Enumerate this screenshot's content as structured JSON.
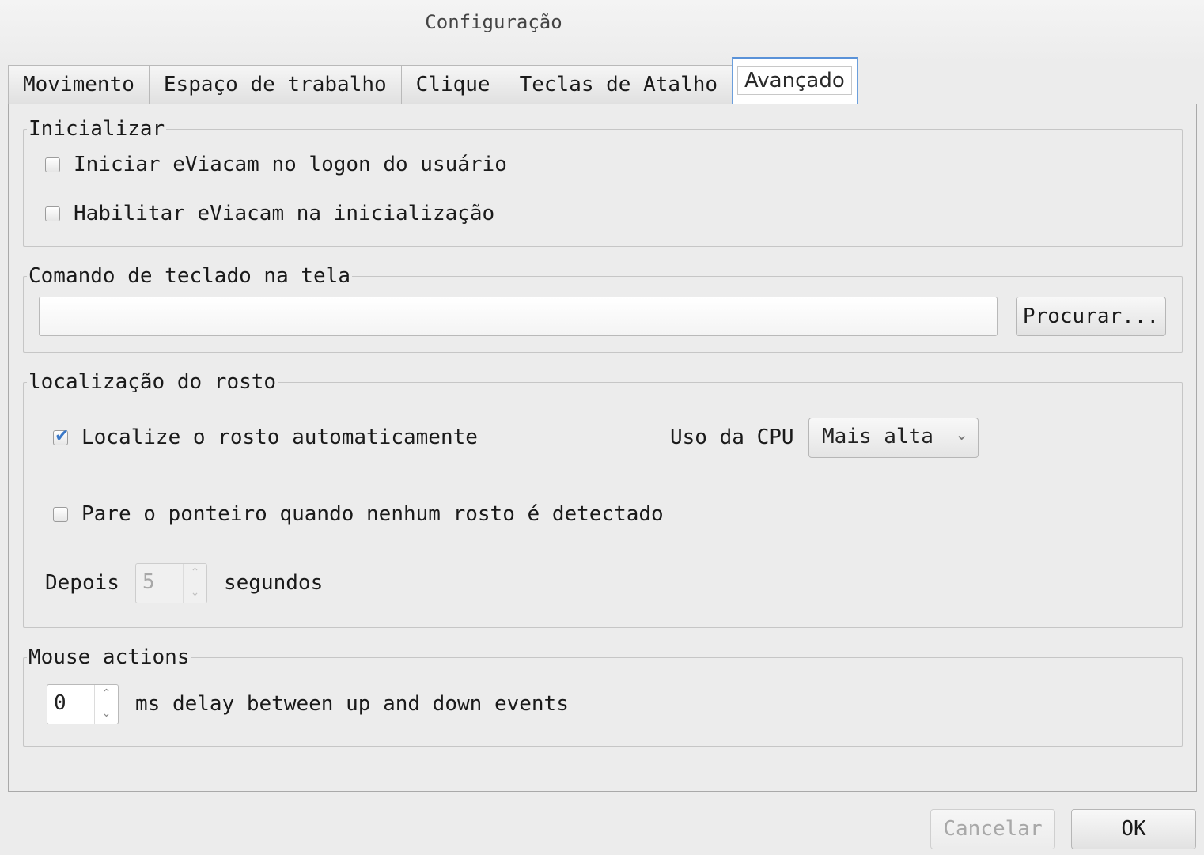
{
  "window": {
    "title": "Configuração"
  },
  "tabs": [
    {
      "label": "Movimento"
    },
    {
      "label": "Espaço de trabalho"
    },
    {
      "label": "Clique"
    },
    {
      "label": "Teclas de Atalho"
    },
    {
      "label": "Avançado",
      "active": true
    }
  ],
  "startup": {
    "legend": "Inicializar",
    "start_on_logon": {
      "label": "Iniciar eViacam no logon do usuário",
      "checked": false
    },
    "enable_on_startup": {
      "label": "Habilitar eViacam na inicialização",
      "checked": false
    }
  },
  "onscreen_keyboard": {
    "legend": "Comando de teclado na tela",
    "command_value": "",
    "browse_label": "Procurar..."
  },
  "face_location": {
    "legend": "localização do rosto",
    "auto_locate": {
      "label": "Localize o rosto automaticamente",
      "checked": true
    },
    "cpu_usage_label": "Uso da CPU",
    "cpu_usage_value": "Mais alta",
    "stop_pointer": {
      "label": "Pare o ponteiro quando nenhum rosto é detectado",
      "checked": false
    },
    "after_label": "Depois",
    "after_value": "5",
    "seconds_label": "segundos"
  },
  "mouse_actions": {
    "legend": "Mouse actions",
    "delay_value": "0",
    "delay_label": "ms delay between up and down events"
  },
  "footer": {
    "cancel_label": "Cancelar",
    "ok_label": "OK"
  },
  "colors": {
    "accent": "#5a92d8",
    "background": "#ececec"
  }
}
